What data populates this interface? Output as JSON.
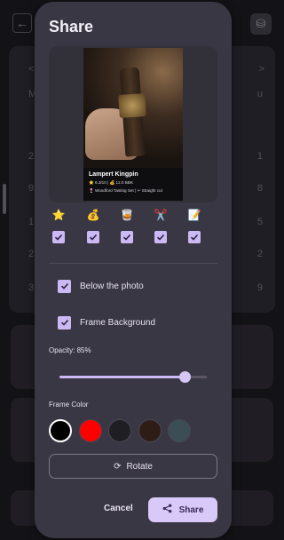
{
  "background": {
    "calendar_nav_prev": "<",
    "calendar_nav_next": ">",
    "left_day_labels": [
      "M",
      "2",
      "9",
      "1",
      "2",
      "3"
    ],
    "right_day_labels": [
      "u",
      "1",
      "8",
      "5",
      "2",
      "9"
    ]
  },
  "dialog": {
    "title": "Share",
    "preview": {
      "name": "Lampert Kingpin",
      "line1": "⭐ 6.3/10  |  💰 12.0 BBK",
      "line2": "🍷 Woodford Tasting Set  |  ✂ Straight cut"
    },
    "field_icons": [
      {
        "icon": "star-icon",
        "glyph": "⭐",
        "checked": true
      },
      {
        "icon": "money-bag-icon",
        "glyph": "💰",
        "checked": true
      },
      {
        "icon": "glass-icon",
        "glyph": "🥃",
        "checked": true
      },
      {
        "icon": "scissors-icon",
        "glyph": "✂️",
        "checked": true
      },
      {
        "icon": "memo-icon",
        "glyph": "📝",
        "checked": true
      }
    ],
    "options": [
      {
        "label": "Below the photo",
        "checked": true
      },
      {
        "label": "Frame Background",
        "checked": true
      }
    ],
    "opacity_label": "Opacity: 85%",
    "opacity_value": 0.85,
    "frame_color_label": "Frame Color",
    "frame_colors": [
      "#000000",
      "#ff0000",
      "#1f1f23",
      "#2e1d16",
      "#3b4d55"
    ],
    "selected_frame_color": "#000000",
    "rotate_label": "Rotate",
    "cancel_label": "Cancel",
    "share_label": "Share"
  },
  "colors": {
    "accent": "#cbb9f4",
    "dialog_bg": "#3a3744"
  }
}
